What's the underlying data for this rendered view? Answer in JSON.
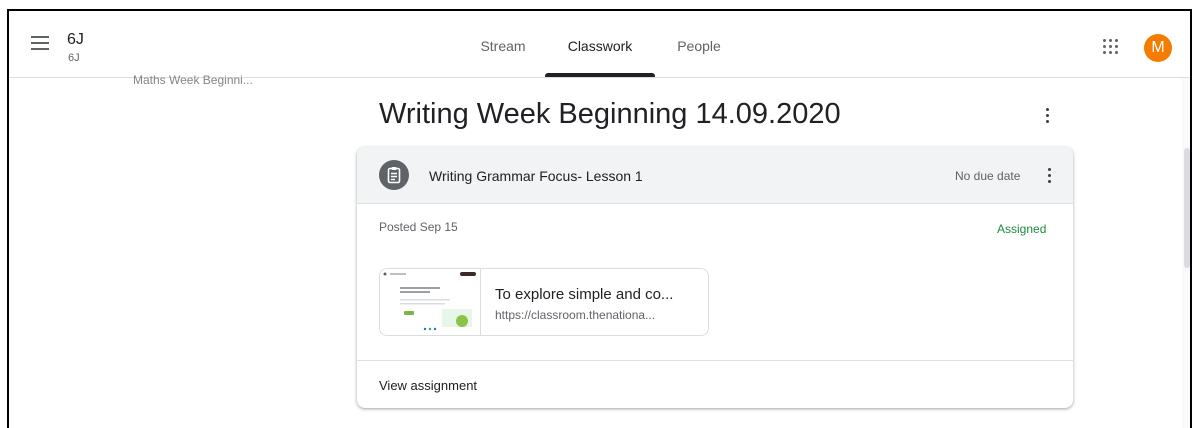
{
  "header": {
    "class_name": "6J",
    "class_section": "6J",
    "tabs": [
      {
        "label": "Stream",
        "active": false
      },
      {
        "label": "Classwork",
        "active": true
      },
      {
        "label": "People",
        "active": false
      }
    ],
    "avatar_letter": "M",
    "avatar_color": "#f57c00",
    "icons": [
      "hamburger-menu-icon",
      "google-apps-icon"
    ]
  },
  "left_panel": {
    "clipped_topic": "Maths Week Beginni..."
  },
  "topic": {
    "title": "Writing Week Beginning 14.09.2020"
  },
  "assignment": {
    "title": "Writing Grammar Focus- Lesson 1",
    "due": "No due date",
    "posted": "Posted Sep 15",
    "status": "Assigned",
    "status_color": "#1e8e3e",
    "attachment": {
      "title": "To explore simple and co...",
      "url": "https://classroom.thenationa..."
    },
    "view_label": "View assignment"
  }
}
